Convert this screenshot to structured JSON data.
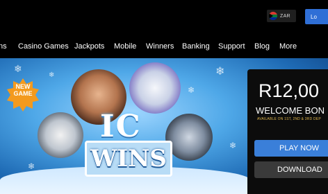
{
  "header": {
    "currency_label": "ZAR",
    "login_label": "Lo"
  },
  "nav": {
    "items": [
      "ns",
      "Casino Games",
      "Jackpots",
      "Mobile",
      "Winners",
      "Banking",
      "Support",
      "Blog",
      "More"
    ]
  },
  "hero": {
    "badge_line1": "NEW",
    "badge_line2": "GAME",
    "logo_top": "IC",
    "logo_bottom": "WINS"
  },
  "promo": {
    "amount": "R12,00",
    "title": "WELCOME BON",
    "subtitle": "AVAILABLE ON 1ST, 2ND & 3RD DEP",
    "play_label": "PLAY NOW",
    "download_label": "DOWNLOAD"
  },
  "colors": {
    "accent_blue": "#3a7fd9",
    "badge_orange": "#f39a1e",
    "promo_gold": "#e0b64c"
  }
}
